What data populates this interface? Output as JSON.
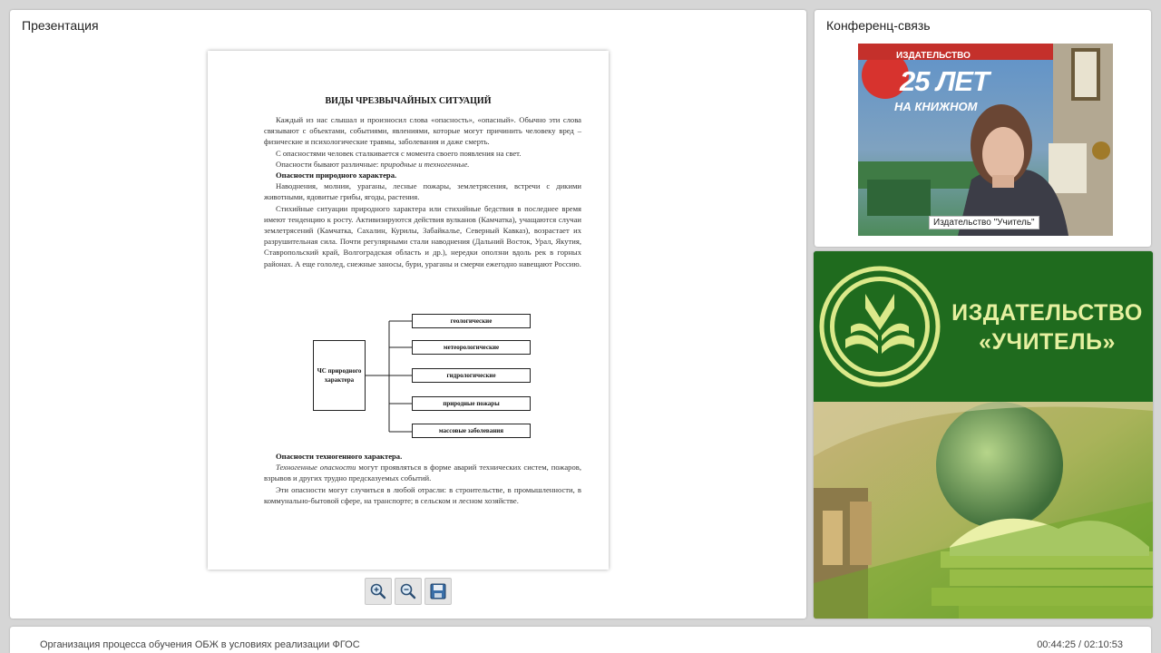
{
  "presentation": {
    "title": "Презентация",
    "document": {
      "heading": "ВИДЫ ЧРЕЗВЫЧАЙНЫХ СИТУАЦИЙ",
      "paragraphs": [
        "Каждый из нас слышал и произносил слова «опасность», «опасный». Обычно эти слова связывают с объектами, событиями, явлениями, которые могут причинить человеку вред – физические и психологические травмы, заболевания и даже смерть.",
        "С опасностями человек сталкивается с момента своего появления на свет.",
        "Опасности бывают различные:",
        "природные и техногенные."
      ],
      "natural_heading": "Опасности природного характера.",
      "natural_paragraphs": [
        "Наводнения, молнии, ураганы, лесные пожары, землетрясения, встречи с дикими животными, ядовитые грибы, ягоды, растения.",
        "Стихийные ситуации природного характера или стихийные бедствия в последнее время имеют тенденцию к росту. Активизируются действия вулканов (Камчатка), учащаются случаи землетрясений (Камчатка, Сахалин, Курилы, Забайкалье, Северный Кавказ), возрастает их разрушительная сила. Почти регулярными стали наводнения (Дальний Восток, Урал, Якутия, Ставропольский край, Волгоградская область и др.), нередки оползни вдоль рек в горных районах. А еще гололед, снежные заносы, бури, ураганы и смерчи ежегодно навещают Россию."
      ],
      "diagram": {
        "source": "ЧС природного характера",
        "types": [
          "геологические",
          "метеорологические",
          "гидрологические",
          "природные пожары",
          "массовые заболевания"
        ]
      },
      "tech_heading": "Опасности техногенного характера.",
      "tech_term": "Техногенные опасности",
      "tech_paragraphs": [
        "могут проявляться в форме аварий технических систем, пожаров, взрывов и других трудно предсказуемых событий.",
        "Эти опасности могут случиться в любой отрасли: в строительстве, в промышленности, в коммунально-бытовой сфере, на транспорте; в сельском и лесном хозяйстве."
      ]
    },
    "toolbar": {
      "zoom_in_icon": "zoom-in-icon",
      "zoom_out_icon": "zoom-out-icon",
      "save_icon": "save-icon"
    }
  },
  "conference": {
    "title": "Конференц-связь",
    "speaker_label": "Издательство \"Учитель\"",
    "poster_years": "25 ЛЕТ",
    "poster_sub": "НА КНИЖНОМ",
    "poster_pub": "ИЗДАТЕЛЬСТВО"
  },
  "brand": {
    "name_line1": "ИЗДАТЕЛЬСТВО",
    "name_line2": "«УЧИТЕЛЬ»"
  },
  "footer": {
    "webinar_title": "Организация процесса обучения ОБЖ в условиях реализации ФГОС",
    "timecode": "00:44:25 / 02:10:53"
  },
  "colors": {
    "brand_green": "#1f6b1e",
    "brand_text": "#e6f0a0",
    "background": "#d6d6d6"
  }
}
